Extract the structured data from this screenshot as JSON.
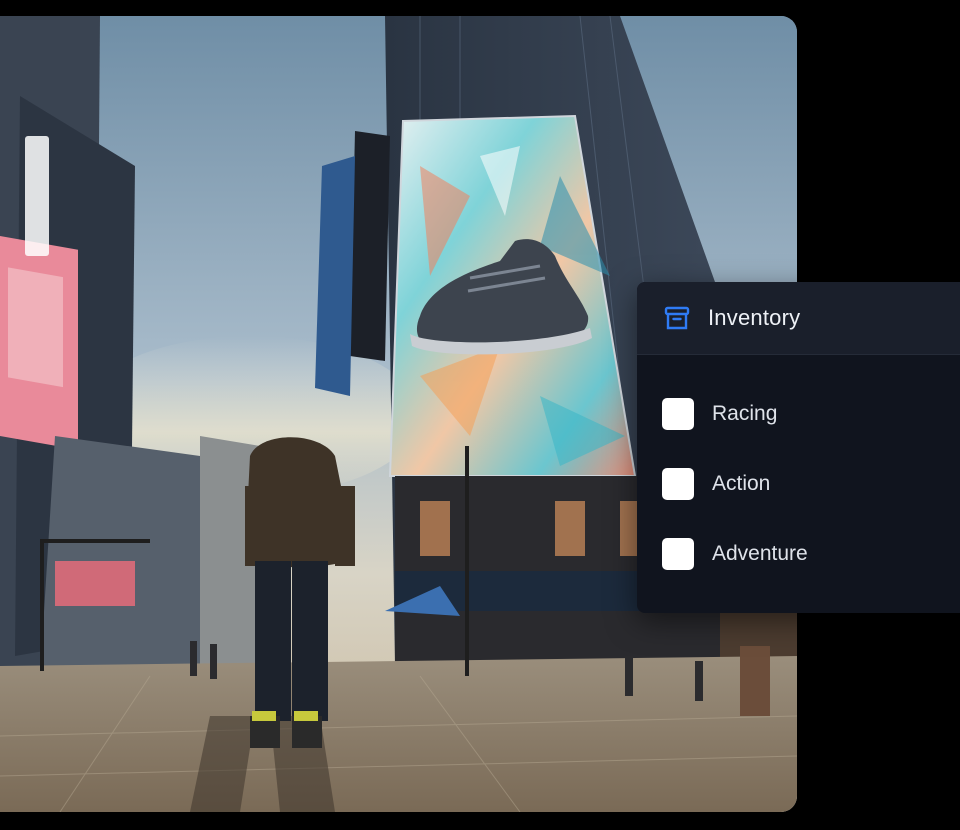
{
  "game": {
    "scene_description_icon": "city-street-scene",
    "billboard_product_icon": "sneaker-icon"
  },
  "inventory_panel": {
    "title": "Inventory",
    "icon": "archive-box-icon",
    "accent_color": "#2f7bf5",
    "options": [
      {
        "label": "Racing",
        "checked": false
      },
      {
        "label": "Action",
        "checked": false
      },
      {
        "label": "Adventure",
        "checked": false
      }
    ]
  }
}
